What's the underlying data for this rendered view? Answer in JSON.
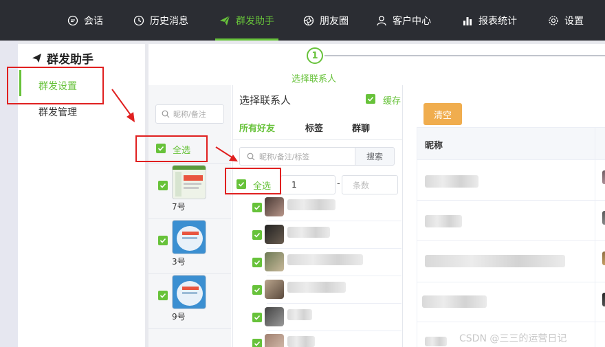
{
  "topnav": {
    "items": [
      {
        "label": "会话",
        "icon": "chat-icon"
      },
      {
        "label": "历史消息",
        "icon": "clock-icon"
      },
      {
        "label": "群发助手",
        "icon": "send-icon",
        "active": true
      },
      {
        "label": "朋友圈",
        "icon": "aperture-icon"
      },
      {
        "label": "客户中心",
        "icon": "user-icon"
      },
      {
        "label": "报表统计",
        "icon": "bar-chart-icon"
      },
      {
        "label": "设置",
        "icon": "gear-icon"
      }
    ]
  },
  "sidebar": {
    "title": "群发助手",
    "items": [
      {
        "label": "群发设置",
        "active": true
      },
      {
        "label": "群发管理"
      }
    ]
  },
  "steps": {
    "number": "1",
    "label": "选择联系人"
  },
  "accounts": {
    "search_placeholder": "昵称/备注",
    "select_all": "全选",
    "list": [
      {
        "name": "7号",
        "checked": true
      },
      {
        "name": "3号",
        "checked": true
      },
      {
        "name": "9号",
        "checked": true
      }
    ]
  },
  "contacts": {
    "title": "选择联系人",
    "cache_label": "缓存",
    "tabs": [
      "所有好友",
      "标签",
      "群聊"
    ],
    "search_placeholder": "昵称/备注/标签",
    "search_button": "搜索",
    "select_all": "全选",
    "range_from": "1",
    "range_dash": "-",
    "range_to_placeholder": "条数"
  },
  "right": {
    "clear_button": "清空",
    "column_name": "昵称"
  },
  "watermark": "CSDN @三三的运营日记",
  "colors": {
    "accent": "#67c23a",
    "nav_bg": "#2b2d33",
    "clear_btn": "#f0ad4e",
    "annotation": "#e02020"
  }
}
